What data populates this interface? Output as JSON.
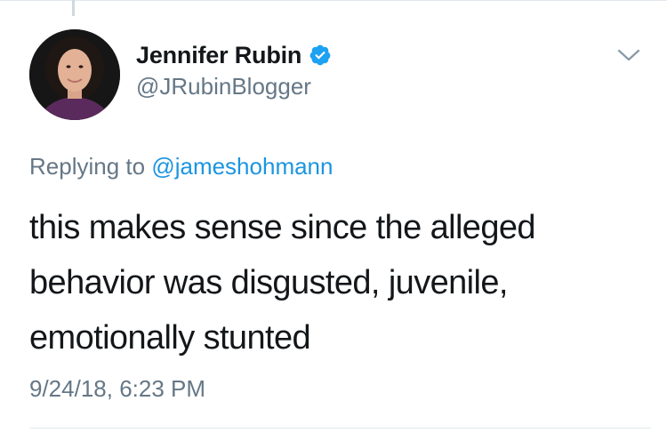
{
  "tweet": {
    "author": {
      "display_name": "Jennifer Rubin",
      "handle": "@JRubinBlogger",
      "verified": true,
      "avatar_icon": "profile-photo"
    },
    "reply_to": {
      "prefix": "Replying to",
      "mention": "@jameshohmann"
    },
    "text_lines": [
      "this makes sense since the alleged",
      "behavior was disgusted, juvenile,",
      "emotionally stunted"
    ],
    "timestamp": "9/24/18, 6:23 PM",
    "menu_icon": "chevron-down-icon"
  },
  "colors": {
    "text": "#14171a",
    "secondary": "#657786",
    "link": "#1b95e0",
    "verified": "#1da1f2"
  }
}
